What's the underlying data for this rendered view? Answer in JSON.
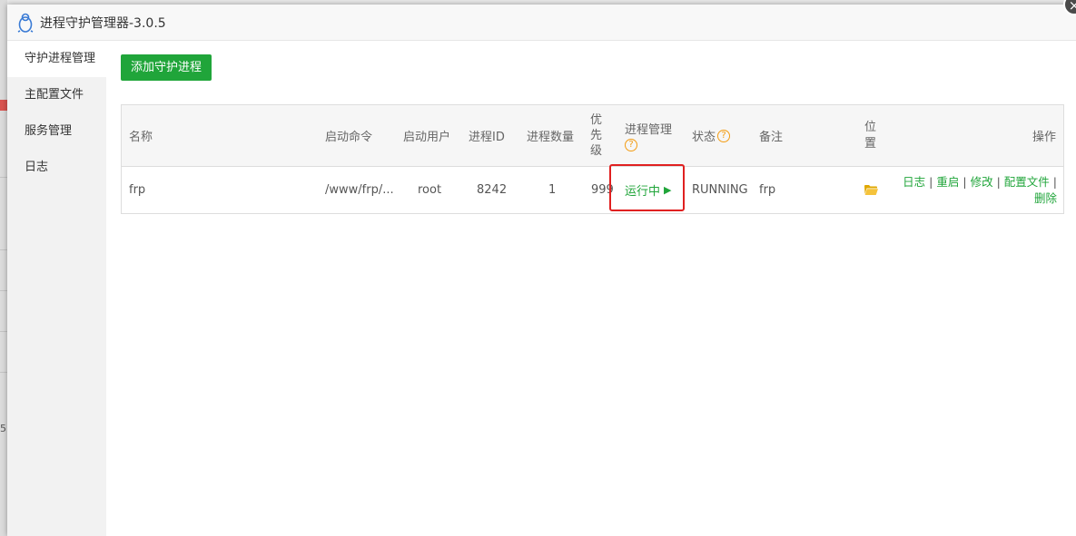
{
  "window": {
    "title": "进程守护管理器-3.0.5"
  },
  "sidebar": {
    "items": [
      {
        "label": "守护进程管理"
      },
      {
        "label": "主配置文件"
      },
      {
        "label": "服务管理"
      },
      {
        "label": "日志"
      }
    ]
  },
  "toolbar": {
    "add_label": "添加守护进程"
  },
  "table": {
    "headers": {
      "name": "名称",
      "command": "启动命令",
      "user": "启动用户",
      "pid": "进程ID",
      "count": "进程数量",
      "priority": "优先级",
      "manage": "进程管理",
      "status": "状态",
      "remark": "备注",
      "location": "位置",
      "actions": "操作"
    },
    "rows": [
      {
        "name": "frp",
        "command": "/www/frp/...",
        "user": "root",
        "pid": "8242",
        "count": "1",
        "priority": "999",
        "manage": "运行中",
        "status": "RUNNING",
        "remark": "frp",
        "actions": {
          "log": "日志",
          "restart": "重启",
          "edit": "修改",
          "config": "配置文件",
          "delete": "删除",
          "sep": "|"
        }
      }
    ]
  },
  "background": {
    "side_number": "5"
  },
  "colors": {
    "accent": "#20a53a",
    "highlight": "#e02020",
    "help": "#f39c12"
  },
  "icons": {
    "logo": "penguin-icon",
    "help": "question-icon",
    "folder": "folder-icon",
    "close": "close-icon",
    "play": "play-icon"
  }
}
